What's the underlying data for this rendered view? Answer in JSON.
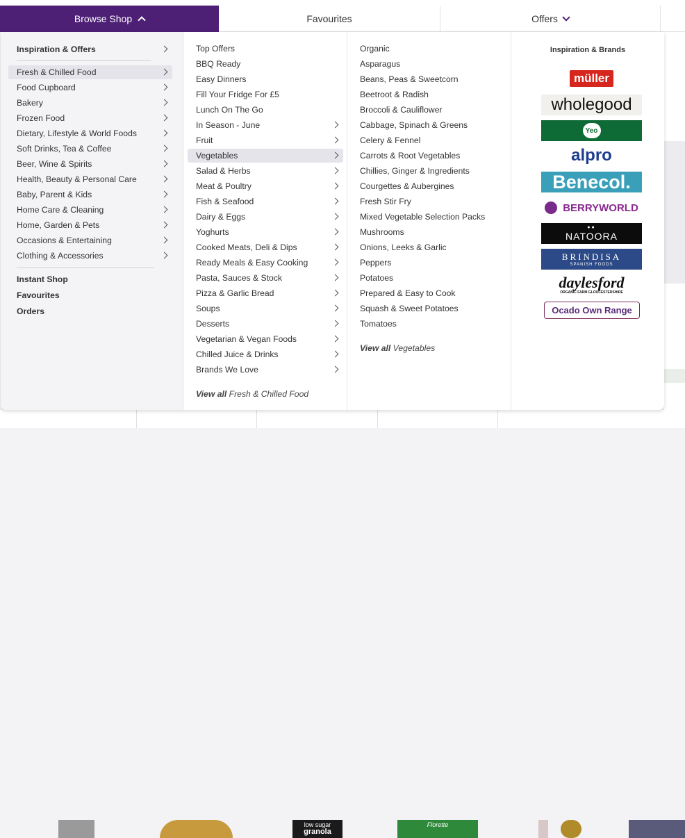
{
  "nav": {
    "browse_label": "Browse Shop",
    "favourites_label": "Favourites",
    "offers_label": "Offers"
  },
  "col1": {
    "top_item": "Inspiration & Offers",
    "categories": [
      "Fresh & Chilled Food",
      "Food Cupboard",
      "Bakery",
      "Frozen Food",
      "Dietary, Lifestyle & World Foods",
      "Soft Drinks, Tea & Coffee",
      "Beer, Wine & Spirits",
      "Health, Beauty & Personal Care",
      "Baby, Parent & Kids",
      "Home Care & Cleaning",
      "Home, Garden & Pets",
      "Occasions & Entertaining",
      "Clothing & Accessories"
    ],
    "selected_index": 0,
    "links": [
      "Instant Shop",
      "Favourites",
      "Orders"
    ]
  },
  "col2": {
    "items": [
      "Top Offers",
      "BBQ Ready",
      "Easy Dinners",
      "Fill Your Fridge For £5",
      "Lunch On The Go",
      "In Season - June",
      "Fruit",
      "Vegetables",
      "Salad & Herbs",
      "Meat & Poultry",
      "Fish & Seafood",
      "Dairy & Eggs",
      "Yoghurts",
      "Cooked Meats, Deli & Dips",
      "Ready Meals & Easy Cooking",
      "Pasta, Sauces & Stock",
      "Pizza & Garlic Bread",
      "Soups",
      "Desserts",
      "Vegetarian & Vegan Foods",
      "Chilled Juice & Drinks",
      "Brands We Love"
    ],
    "selected_index": 7,
    "view_all_prefix": "View all",
    "view_all_target": "Fresh & Chilled Food"
  },
  "col3": {
    "items": [
      "Organic",
      "Asparagus",
      "Beans, Peas & Sweetcorn",
      "Beetroot & Radish",
      "Broccoli & Cauliflower",
      "Cabbage, Spinach & Greens",
      "Celery & Fennel",
      "Carrots & Root Vegetables",
      "Chillies, Ginger & Ingredients",
      "Courgettes & Aubergines",
      "Fresh Stir Fry",
      "Mixed Vegetable Selection Packs",
      "Mushrooms",
      "Onions, Leeks & Garlic",
      "Peppers",
      "Potatoes",
      "Prepared & Easy to Cook",
      "Squash & Sweet Potatoes",
      "Tomatoes"
    ],
    "view_all_prefix": "View all",
    "view_all_target": "Vegetables"
  },
  "brands": {
    "title": "Inspiration & Brands",
    "logos": {
      "muller": "müller",
      "wholegood": "wholegood",
      "yeo": "Yeo",
      "alpro": "alpro",
      "benecol": "Benecol.",
      "berryworld": "BERRYWORLD",
      "natoora": "NATOORA",
      "brindisa": "BRINDISA",
      "brindisa_sub": "SPANISH FOODS",
      "daylesford": "daylesford",
      "daylesford_sub": "ORGANIC FARM GLOUCESTERSHIRE",
      "ocado_own": "Ocado Own Range"
    }
  },
  "background": {
    "product_text_1": "low sugar",
    "product_text_2": "granola",
    "product_text_3": "Florette"
  },
  "colors": {
    "brand_purple": "#4d1f75",
    "selected_row": "#e4e4ea"
  }
}
